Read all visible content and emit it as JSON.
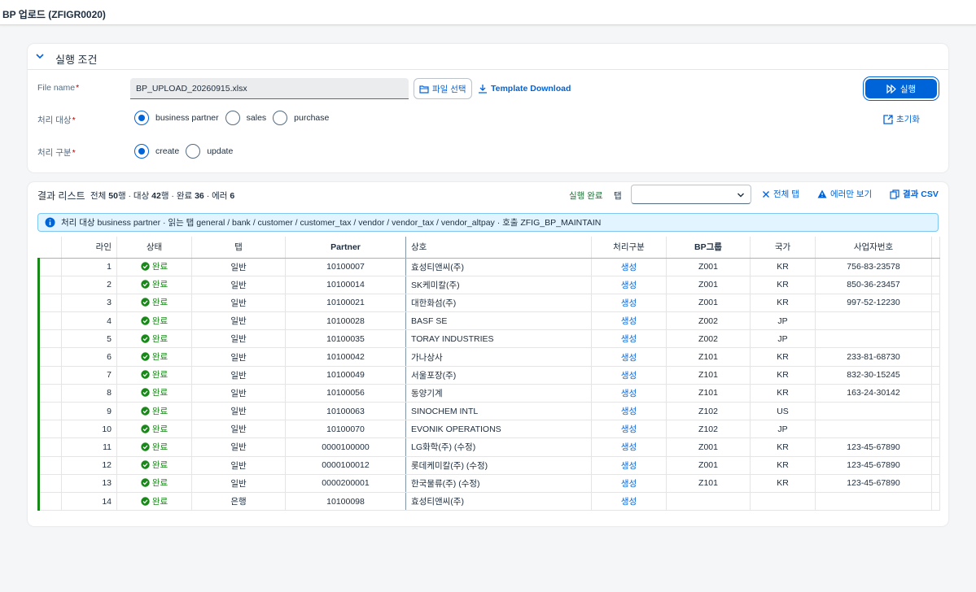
{
  "app": {
    "title": "BP 업로드 (ZFIGR0020)"
  },
  "conditions": {
    "section_title": "실행 조건",
    "file_name_label": "File name",
    "file_name_value": "BP_UPLOAD_20260915.xlsx",
    "file_select_label": "파일 선택",
    "template_download_label": "Template Download",
    "run_label": "실행",
    "reset_label": "초기화",
    "target_label": "처리 대상",
    "target_options": [
      "business partner",
      "sales",
      "purchase"
    ],
    "target_selected": "business partner",
    "mode_label": "처리 구분",
    "mode_options": [
      "create",
      "update"
    ],
    "mode_selected": "create",
    "required_mark": "*"
  },
  "results": {
    "title": "결과 리스트",
    "summary_prefix1": "전체 ",
    "total": "50",
    "summary_mid1": "행 · 대상 ",
    "targets": "42",
    "summary_mid2": "행 · 완료 ",
    "done": "36",
    "summary_mid3": " · 에러 ",
    "errors": "6",
    "run_status": "실행 완료",
    "tab_label": "탭",
    "tab_select_value": "",
    "all_tabs_label": "전체 탭",
    "errors_only_label": "에러만 보기",
    "csv_label": "결과 CSV",
    "info_text": "처리 대상 business partner · 읽는 탭 general / bank / customer / customer_tax / vendor / vendor_tax / vendor_altpay · 호출 ZFIG_BP_MAINTAIN",
    "columns": {
      "line": "라인",
      "status": "상태",
      "tab": "탭",
      "partner": "Partner",
      "name": "상호",
      "mode": "처리구분",
      "bp_group": "BP그룹",
      "country": "국가",
      "biz_no": "사업자번호"
    },
    "rows": [
      {
        "line": "1",
        "status": "완료",
        "tab": "일반",
        "partner": "10100007",
        "name": "효성티앤씨(주)",
        "mode": "생성",
        "bp_group": "Z001",
        "country": "KR",
        "biz_no": "756-83-23578"
      },
      {
        "line": "2",
        "status": "완료",
        "tab": "일반",
        "partner": "10100014",
        "name": "SK케미칼(주)",
        "mode": "생성",
        "bp_group": "Z001",
        "country": "KR",
        "biz_no": "850-36-23457"
      },
      {
        "line": "3",
        "status": "완료",
        "tab": "일반",
        "partner": "10100021",
        "name": "대한화섬(주)",
        "mode": "생성",
        "bp_group": "Z001",
        "country": "KR",
        "biz_no": "997-52-12230"
      },
      {
        "line": "4",
        "status": "완료",
        "tab": "일반",
        "partner": "10100028",
        "name": "BASF SE",
        "mode": "생성",
        "bp_group": "Z002",
        "country": "JP",
        "biz_no": ""
      },
      {
        "line": "5",
        "status": "완료",
        "tab": "일반",
        "partner": "10100035",
        "name": "TORAY INDUSTRIES",
        "mode": "생성",
        "bp_group": "Z002",
        "country": "JP",
        "biz_no": ""
      },
      {
        "line": "6",
        "status": "완료",
        "tab": "일반",
        "partner": "10100042",
        "name": "가나상사",
        "mode": "생성",
        "bp_group": "Z101",
        "country": "KR",
        "biz_no": "233-81-68730"
      },
      {
        "line": "7",
        "status": "완료",
        "tab": "일반",
        "partner": "10100049",
        "name": "서울포장(주)",
        "mode": "생성",
        "bp_group": "Z101",
        "country": "KR",
        "biz_no": "832-30-15245"
      },
      {
        "line": "8",
        "status": "완료",
        "tab": "일반",
        "partner": "10100056",
        "name": "동양기계",
        "mode": "생성",
        "bp_group": "Z101",
        "country": "KR",
        "biz_no": "163-24-30142"
      },
      {
        "line": "9",
        "status": "완료",
        "tab": "일반",
        "partner": "10100063",
        "name": "SINOCHEM INTL",
        "mode": "생성",
        "bp_group": "Z102",
        "country": "US",
        "biz_no": ""
      },
      {
        "line": "10",
        "status": "완료",
        "tab": "일반",
        "partner": "10100070",
        "name": "EVONIK OPERATIONS",
        "mode": "생성",
        "bp_group": "Z102",
        "country": "JP",
        "biz_no": ""
      },
      {
        "line": "11",
        "status": "완료",
        "tab": "일반",
        "partner": "0000100000",
        "name": "LG화학(주) (수정)",
        "mode": "생성",
        "bp_group": "Z001",
        "country": "KR",
        "biz_no": "123-45-67890"
      },
      {
        "line": "12",
        "status": "완료",
        "tab": "일반",
        "partner": "0000100012",
        "name": "롯데케미칼(주) (수정)",
        "mode": "생성",
        "bp_group": "Z001",
        "country": "KR",
        "biz_no": "123-45-67890"
      },
      {
        "line": "13",
        "status": "완료",
        "tab": "일반",
        "partner": "0000200001",
        "name": "한국물류(주) (수정)",
        "mode": "생성",
        "bp_group": "Z101",
        "country": "KR",
        "biz_no": "123-45-67890"
      },
      {
        "line": "14",
        "status": "완료",
        "tab": "은행",
        "partner": "10100098",
        "name": "효성티앤씨(주)",
        "mode": "생성",
        "bp_group": "",
        "country": "",
        "biz_no": ""
      }
    ]
  },
  "colors": {
    "accent": "#0064d9",
    "success": "#188918",
    "info_bg": "#e1f4ff"
  },
  "icons": {
    "collapse": "chevron-down-icon",
    "file_select": "folder-icon",
    "download": "download-icon",
    "run": "play-icon",
    "reset": "reset-icon",
    "all_tabs": "close-icon",
    "errors_only": "warning-icon",
    "csv": "copy-icon",
    "info": "info-icon",
    "status_done": "check-circle-icon"
  }
}
